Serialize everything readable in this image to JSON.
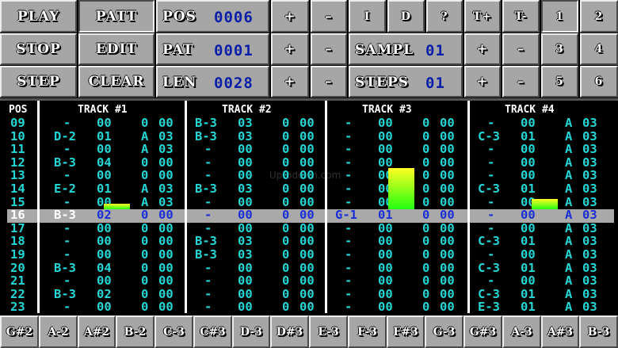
{
  "controls": {
    "play": "PLAY",
    "patt": "PATT",
    "stop": "STOP",
    "edit": "EDIT",
    "step": "STEP",
    "clear": "CLEAR",
    "pos_label": "POS",
    "pos_value": "0006",
    "pat_label": "PAT",
    "pat_value": "0001",
    "len_label": "LEN",
    "len_value": "0028",
    "sampl_label": "SAMPL",
    "sampl_value": "01",
    "steps_label": "STEPS",
    "steps_value": "01",
    "plus": "+",
    "minus": "–",
    "insert": "I",
    "delete": "D",
    "help": "?",
    "tempo_up": "T+",
    "tempo_down": "T-",
    "track_buttons": [
      "1",
      "2",
      "3",
      "4",
      "5",
      "6"
    ]
  },
  "tracker": {
    "pos_header": "POS",
    "track_headers": [
      "TRACK #1",
      "TRACK #2",
      "TRACK #3",
      "TRACK #4"
    ],
    "rows": [
      {
        "pos": "09",
        "t": [
          [
            "-",
            "00",
            "0",
            "00"
          ],
          [
            "B-3",
            "03",
            "0",
            "00"
          ],
          [
            "-",
            "00",
            "0",
            "00"
          ],
          [
            "-",
            "00",
            "A",
            "03"
          ]
        ]
      },
      {
        "pos": "10",
        "t": [
          [
            "D-2",
            "01",
            "A",
            "03"
          ],
          [
            "B-3",
            "03",
            "0",
            "00"
          ],
          [
            "-",
            "00",
            "0",
            "00"
          ],
          [
            "C-3",
            "01",
            "A",
            "03"
          ]
        ]
      },
      {
        "pos": "11",
        "t": [
          [
            "-",
            "00",
            "A",
            "03"
          ],
          [
            "-",
            "00",
            "0",
            "00"
          ],
          [
            "-",
            "00",
            "0",
            "00"
          ],
          [
            "-",
            "00",
            "A",
            "03"
          ]
        ]
      },
      {
        "pos": "12",
        "t": [
          [
            "B-3",
            "04",
            "0",
            "00"
          ],
          [
            "-",
            "00",
            "0",
            "00"
          ],
          [
            "-",
            "00",
            "0",
            "00"
          ],
          [
            "-",
            "00",
            "A",
            "03"
          ]
        ]
      },
      {
        "pos": "13",
        "t": [
          [
            "-",
            "00",
            "0",
            "00"
          ],
          [
            "-",
            "00",
            "0",
            "00"
          ],
          [
            "-",
            "00",
            "0",
            "00"
          ],
          [
            "-",
            "00",
            "A",
            "03"
          ]
        ]
      },
      {
        "pos": "14",
        "t": [
          [
            "E-2",
            "01",
            "A",
            "03"
          ],
          [
            "B-3",
            "03",
            "0",
            "00"
          ],
          [
            "-",
            "00",
            "0",
            "00"
          ],
          [
            "C-3",
            "01",
            "A",
            "03"
          ]
        ]
      },
      {
        "pos": "15",
        "t": [
          [
            "-",
            "00",
            "A",
            "03"
          ],
          [
            "-",
            "00",
            "0",
            "00"
          ],
          [
            "-",
            "00",
            "0",
            "00"
          ],
          [
            "-",
            "00",
            "A",
            "03"
          ]
        ]
      },
      {
        "pos": "16",
        "t": [
          [
            "B-3",
            "02",
            "0",
            "00"
          ],
          [
            "-",
            "00",
            "0",
            "00"
          ],
          [
            "G-1",
            "01",
            "0",
            "00"
          ],
          [
            "-",
            "00",
            "A",
            "03"
          ]
        ]
      },
      {
        "pos": "17",
        "t": [
          [
            "-",
            "00",
            "0",
            "00"
          ],
          [
            "-",
            "00",
            "0",
            "00"
          ],
          [
            "-",
            "00",
            "0",
            "00"
          ],
          [
            "-",
            "00",
            "A",
            "03"
          ]
        ]
      },
      {
        "pos": "18",
        "t": [
          [
            "-",
            "00",
            "0",
            "00"
          ],
          [
            "B-3",
            "03",
            "0",
            "00"
          ],
          [
            "-",
            "00",
            "0",
            "00"
          ],
          [
            "C-3",
            "01",
            "A",
            "03"
          ]
        ]
      },
      {
        "pos": "19",
        "t": [
          [
            "-",
            "00",
            "0",
            "00"
          ],
          [
            "B-3",
            "03",
            "0",
            "00"
          ],
          [
            "-",
            "00",
            "0",
            "00"
          ],
          [
            "-",
            "00",
            "A",
            "03"
          ]
        ]
      },
      {
        "pos": "20",
        "t": [
          [
            "B-3",
            "04",
            "0",
            "00"
          ],
          [
            "-",
            "00",
            "0",
            "00"
          ],
          [
            "-",
            "00",
            "0",
            "00"
          ],
          [
            "C-3",
            "01",
            "A",
            "03"
          ]
        ]
      },
      {
        "pos": "21",
        "t": [
          [
            "-",
            "00",
            "0",
            "00"
          ],
          [
            "-",
            "00",
            "0",
            "00"
          ],
          [
            "-",
            "00",
            "0",
            "00"
          ],
          [
            "-",
            "00",
            "A",
            "03"
          ]
        ]
      },
      {
        "pos": "22",
        "t": [
          [
            "B-3",
            "02",
            "0",
            "00"
          ],
          [
            "-",
            "00",
            "0",
            "00"
          ],
          [
            "-",
            "00",
            "0",
            "00"
          ],
          [
            "C-3",
            "01",
            "A",
            "03"
          ]
        ]
      },
      {
        "pos": "23",
        "t": [
          [
            "-",
            "00",
            "0",
            "00"
          ],
          [
            "-",
            "00",
            "0",
            "00"
          ],
          [
            "-",
            "00",
            "0",
            "00"
          ],
          [
            "E-3",
            "01",
            "A",
            "03"
          ]
        ]
      }
    ],
    "vu_levels": [
      0.09,
      0.0,
      0.65,
      0.16
    ]
  },
  "keyboard": [
    "G#2",
    "A-2",
    "A#2",
    "B-2",
    "C-3",
    "C#3",
    "D-3",
    "D#3",
    "E-3",
    "F-3",
    "F#3",
    "G-3",
    "G#3",
    "A-3",
    "A#3",
    "B-3"
  ],
  "watermark": "Uptodown.com",
  "colors": {
    "text": "#25d6d6",
    "highlight_text": "#1a2ed6",
    "button": "#a6a6a6",
    "value": "#0a1ea8"
  }
}
